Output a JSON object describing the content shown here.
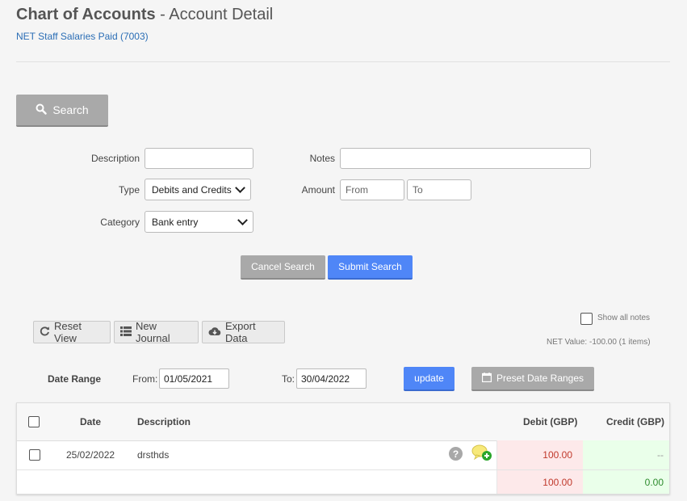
{
  "header": {
    "title_bold": "Chart of Accounts",
    "title_rest": " - Account Detail",
    "account_link": "NET Staff Salaries Paid (7003)"
  },
  "search": {
    "toggle_label": "Search",
    "description_label": "Description",
    "description_value": "",
    "notes_label": "Notes",
    "notes_value": "",
    "type_label": "Type",
    "type_selected": "Debits and Credits",
    "amount_label": "Amount",
    "amount_from_placeholder": "From",
    "amount_to_placeholder": "To",
    "category_label": "Category",
    "category_selected": "Bank entry",
    "cancel_label": "Cancel Search",
    "submit_label": "Submit Search"
  },
  "toolbar": {
    "reset_label": "Reset View",
    "new_journal_label": "New Journal",
    "export_label": "Export Data",
    "show_all_notes_label": "Show all notes",
    "net_value_text": "NET Value: -100.00 (1 items)"
  },
  "date_range": {
    "label": "Date Range",
    "from_label": "From:",
    "from_value": "01/05/2021",
    "to_label": "To:",
    "to_value": "30/04/2022",
    "update_label": "update",
    "preset_label": "Preset Date Ranges"
  },
  "table": {
    "columns": [
      "Date",
      "Description",
      "Debit (GBP)",
      "Credit (GBP)"
    ],
    "rows": [
      {
        "date": "25/02/2022",
        "description": "drsthds",
        "debit": "100.00",
        "credit": "--"
      }
    ],
    "totals": {
      "debit": "100.00",
      "credit": "0.00"
    }
  },
  "colors": {
    "primary_blue": "#4f86f7",
    "gray_button": "#a9a9a9",
    "debit_red": "#c0392b",
    "credit_green": "#2e8b2e",
    "link_blue": "#2a6db5"
  },
  "icons": [
    "search-icon",
    "refresh-icon",
    "list-icon",
    "cloud-download-icon",
    "calendar-icon",
    "help-icon",
    "add-comment-icon",
    "chevron-down-icon"
  ]
}
